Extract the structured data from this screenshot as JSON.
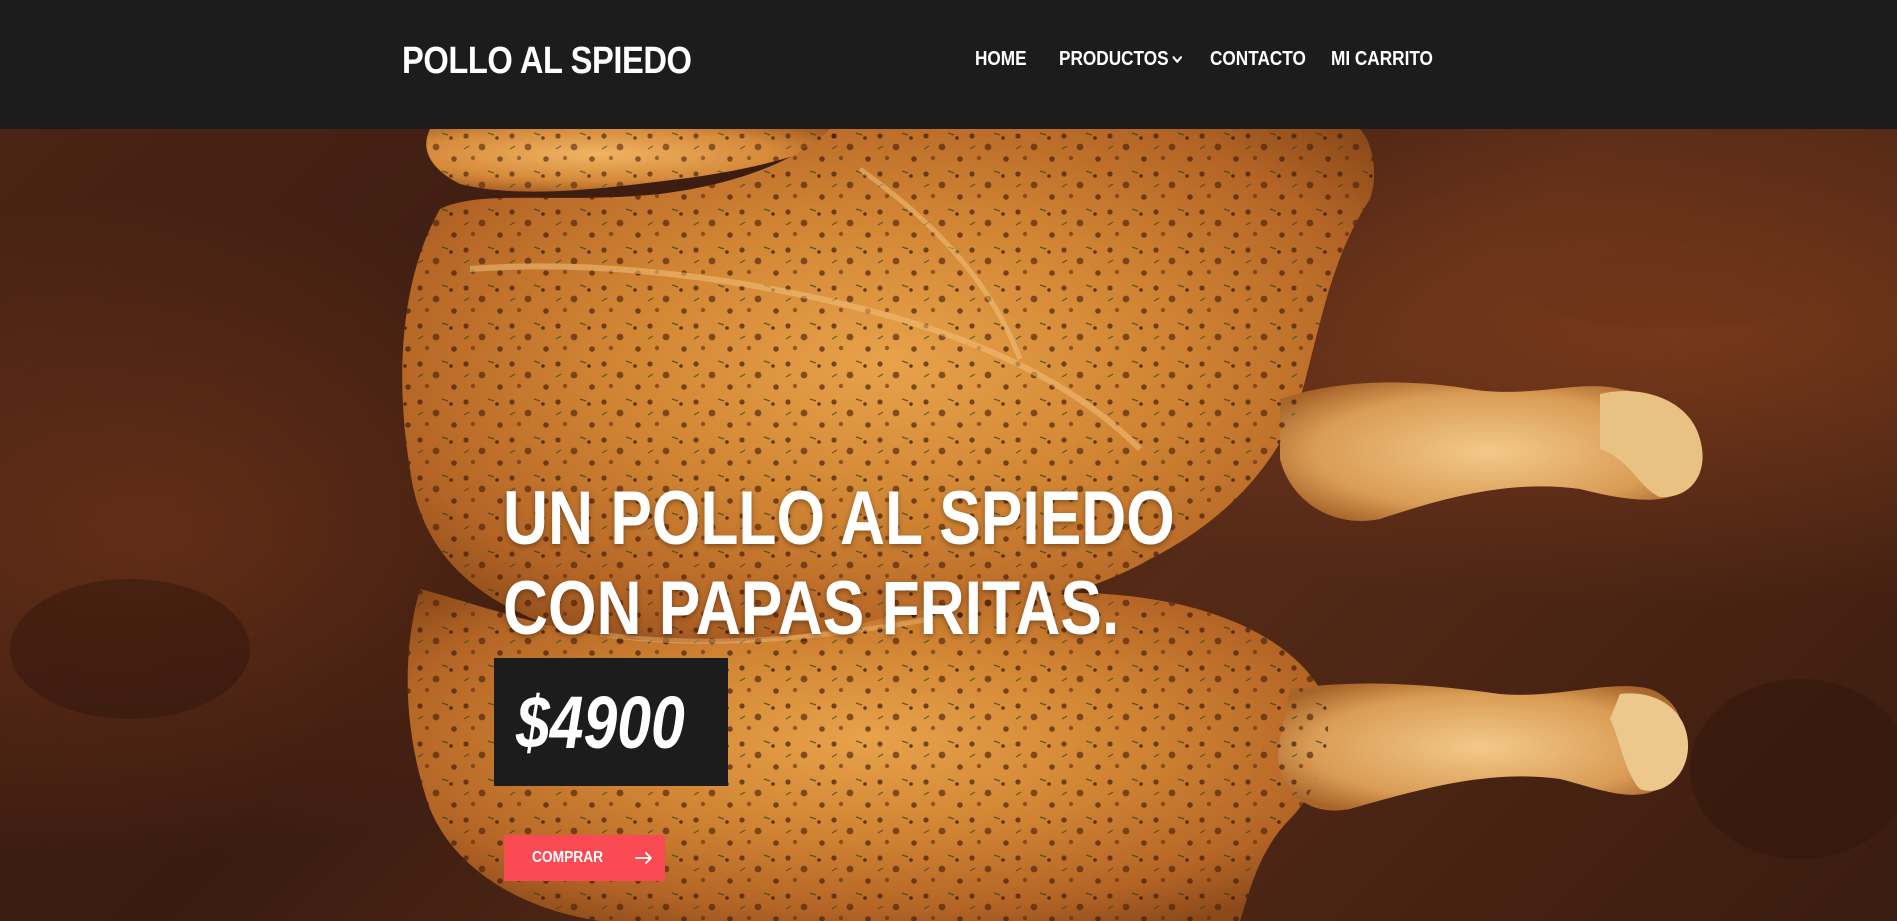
{
  "brand": {
    "name": "POLLO AL SPIEDO"
  },
  "nav": {
    "items": [
      {
        "label": "HOME"
      },
      {
        "label": "PRODUCTOS",
        "icon": "chevron-down-icon"
      },
      {
        "label": "CONTACTO"
      },
      {
        "label": "MI CARRITO"
      }
    ]
  },
  "hero": {
    "title_line1": "UN POLLO AL SPIEDO",
    "title_line2": "CON PAPAS FRITAS.",
    "price": "$4900",
    "button_label": "COMPRAR",
    "button_icon": "arrow-right-icon",
    "image": "roast-chicken-photo"
  },
  "colors": {
    "navbar_bg": "#1c1c1c",
    "accent": "#fa4a53",
    "price_box_bg": "#1c1c1c",
    "text": "#ffffff"
  }
}
